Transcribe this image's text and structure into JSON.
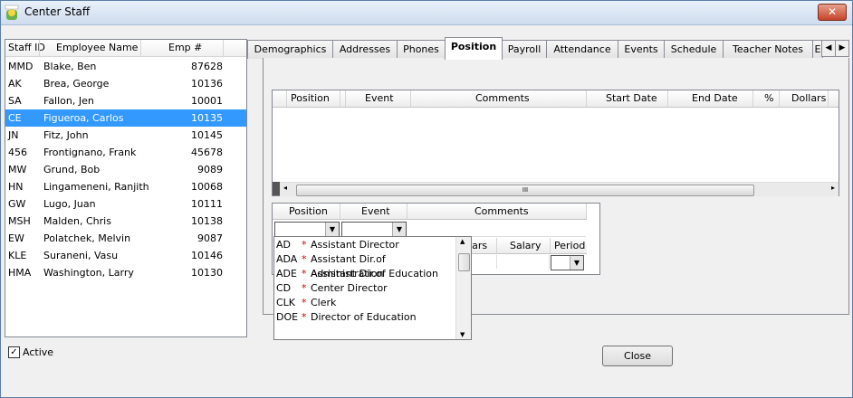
{
  "window": {
    "title": "Center Staff",
    "close_glyph": "✕"
  },
  "staff_list": {
    "columns": [
      "Staff ID",
      "Employee Name",
      "Emp #"
    ],
    "rows": [
      {
        "id": "MMD",
        "name": "Blake, Ben",
        "emp": "87628"
      },
      {
        "id": "AK",
        "name": "Brea, George",
        "emp": "10136"
      },
      {
        "id": "SA",
        "name": "Fallon, Jen",
        "emp": "10001"
      },
      {
        "id": "CE",
        "name": "Figueroa, Carlos",
        "emp": "10135"
      },
      {
        "id": "JN",
        "name": "Fitz, John",
        "emp": "10145"
      },
      {
        "id": "456",
        "name": "Frontignano, Frank",
        "emp": "45678"
      },
      {
        "id": "MW",
        "name": "Grund, Bob",
        "emp": "9089"
      },
      {
        "id": "HN",
        "name": "Lingameneni, Ranjith",
        "emp": "10068"
      },
      {
        "id": "GW",
        "name": "Lugo, Juan",
        "emp": "10111"
      },
      {
        "id": "MSH",
        "name": "Malden, Chris",
        "emp": "10138"
      },
      {
        "id": "EW",
        "name": "Polatchek, Melvin",
        "emp": "9087"
      },
      {
        "id": "KLE",
        "name": "Suraneni, Vasu",
        "emp": "10146"
      },
      {
        "id": "HMA",
        "name": "Washington, Larry",
        "emp": "10130"
      }
    ],
    "selected_id": "CE"
  },
  "active_checkbox": {
    "label": "Active",
    "checked": true
  },
  "tabs": [
    "Demographics",
    "Addresses",
    "Phones",
    "Position",
    "Payroll",
    "Attendance",
    "Events",
    "Schedule",
    "Teacher Notes",
    "E"
  ],
  "active_tab": "Position",
  "position_grid": {
    "columns": [
      "Position",
      "Event",
      "Comments",
      "Start Date",
      "End Date",
      "%",
      "Dollars"
    ],
    "scroll_grip": "III"
  },
  "editor": {
    "columns_top": [
      "Position",
      "Event",
      "Comments"
    ],
    "columns_bottom": [
      "llars",
      "Salary",
      "Period"
    ]
  },
  "position_dropdown": [
    {
      "code": "AD",
      "label": "Assistant Director"
    },
    {
      "code": "ADA",
      "label": "Assistant Dir.of Administration"
    },
    {
      "code": "ADE",
      "label": "Assistant Dir.of Education"
    },
    {
      "code": "CD",
      "label": "Center Director"
    },
    {
      "code": "CLK",
      "label": "Clerk"
    },
    {
      "code": "DOE",
      "label": "Director of Education"
    }
  ],
  "required_marker": "*",
  "close_button": "Close",
  "colors": {
    "selection": "#3399ff",
    "required": "#cc0000"
  }
}
